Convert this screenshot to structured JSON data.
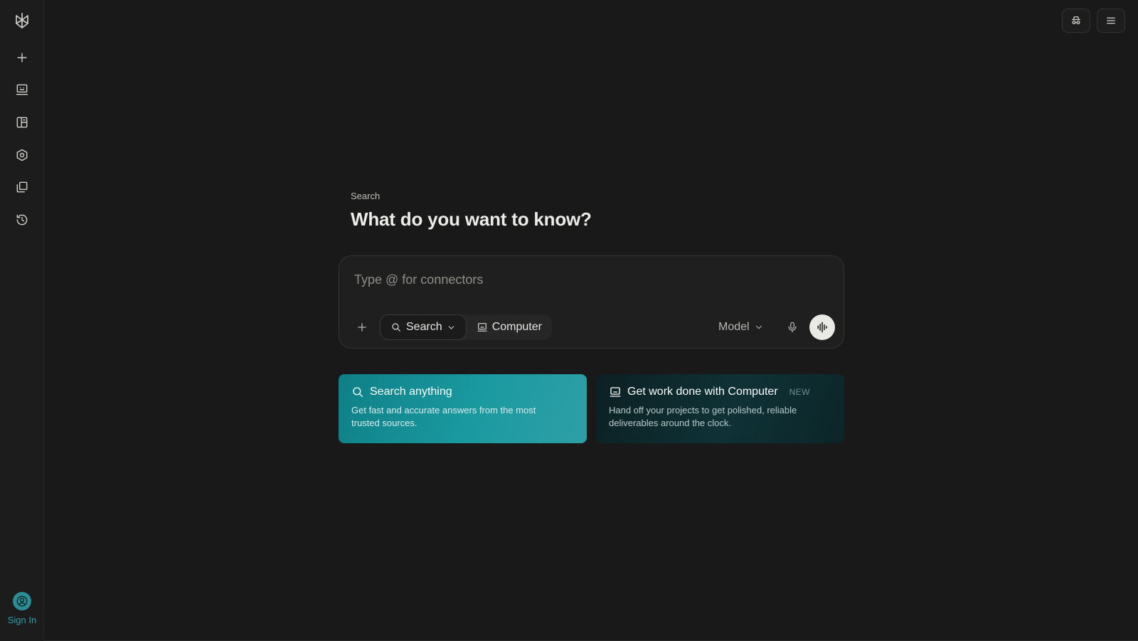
{
  "sidebar": {
    "items": [
      {
        "name": "logo",
        "icon": "logo-icon"
      },
      {
        "name": "new-thread",
        "icon": "plus-icon"
      },
      {
        "name": "computer",
        "icon": "computer-icon"
      },
      {
        "name": "library",
        "icon": "library-icon"
      },
      {
        "name": "discover",
        "icon": "discover-icon"
      },
      {
        "name": "spaces",
        "icon": "spaces-icon"
      },
      {
        "name": "history",
        "icon": "history-icon"
      }
    ],
    "sign_in_label": "Sign In"
  },
  "header": {
    "incognito_icon": "incognito-icon",
    "menu_icon": "menu-icon"
  },
  "main": {
    "eyebrow": "Search",
    "headline": "What do you want to know?",
    "composer": {
      "placeholder": "Type @ for connectors",
      "modes": [
        {
          "label": "Search",
          "icon": "search-icon",
          "active": true
        },
        {
          "label": "Computer",
          "icon": "computer-icon",
          "active": false
        }
      ],
      "model_label": "Model"
    },
    "cards": [
      {
        "title": "Search anything",
        "description": "Get fast and accurate answers from the most trusted sources.",
        "icon": "search-icon"
      },
      {
        "title": "Get work done with Computer",
        "badge": "NEW",
        "description": "Hand off your projects to get polished, reliable deliverables around the clock.",
        "icon": "computer-icon"
      }
    ]
  },
  "colors": {
    "background": "#191919",
    "sidebar": "#1c1c1c",
    "accent": "#2fa0a8",
    "card_search": "#1a9aa0",
    "card_computer": "#0f3236"
  }
}
